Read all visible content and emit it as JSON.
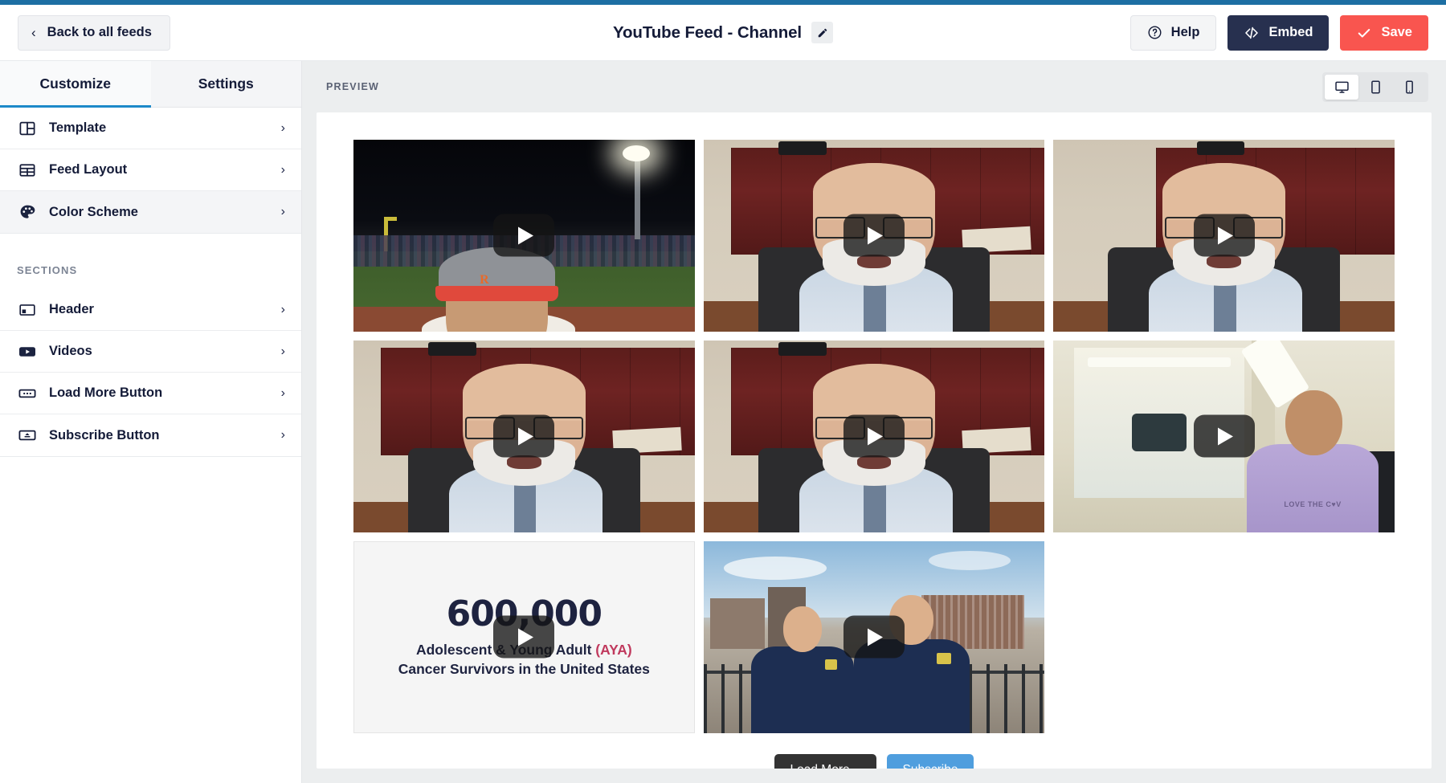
{
  "header": {
    "back_label": "Back to all feeds",
    "back_icon": "chevron-left-icon",
    "title": "YouTube Feed - Channel",
    "edit_icon": "pencil-icon",
    "help_label": "Help",
    "help_icon": "question-circle-icon",
    "embed_label": "Embed",
    "embed_icon": "code-brackets-icon",
    "save_label": "Save",
    "save_icon": "checkmark-icon",
    "colors": {
      "embed_bg": "#27304f",
      "save_bg": "#f9554f",
      "top_strip": "#1d6fa3"
    }
  },
  "sidebar": {
    "tabs": [
      {
        "label": "Customize",
        "active": true
      },
      {
        "label": "Settings",
        "active": false
      }
    ],
    "main_items": [
      {
        "label": "Template",
        "icon": "template-layout-icon",
        "chevron": "›",
        "selected": false
      },
      {
        "label": "Feed Layout",
        "icon": "grid-layout-icon",
        "chevron": "›",
        "selected": false
      },
      {
        "label": "Color Scheme",
        "icon": "palette-icon",
        "chevron": "›",
        "selected": true
      }
    ],
    "sections_heading": "SECTIONS",
    "section_items": [
      {
        "label": "Header",
        "icon": "header-block-icon",
        "chevron": "›"
      },
      {
        "label": "Videos",
        "icon": "youtube-play-icon",
        "chevron": "›"
      },
      {
        "label": "Load More Button",
        "icon": "load-more-icon",
        "chevron": "›"
      },
      {
        "label": "Subscribe Button",
        "icon": "subscribe-icon",
        "chevron": "›"
      }
    ],
    "accent_color": "#1d89c9"
  },
  "preview": {
    "label": "PREVIEW",
    "devices": [
      {
        "name": "desktop",
        "icon": "monitor-icon",
        "active": true
      },
      {
        "name": "tablet",
        "icon": "tablet-icon",
        "active": false
      },
      {
        "name": "mobile",
        "icon": "mobile-icon",
        "active": false
      }
    ],
    "videos": [
      {
        "id": 1,
        "kind": "football-night-game",
        "alt": "Night football game with spectator wearing R cap",
        "play_icon": "play-icon"
      },
      {
        "id": 2,
        "kind": "office-man",
        "alt": "Bearded man with glasses in office",
        "play_icon": "play-icon"
      },
      {
        "id": 3,
        "kind": "office-man",
        "alt": "Bearded man with glasses in office",
        "play_icon": "play-icon"
      },
      {
        "id": 4,
        "kind": "office-man",
        "alt": "Bearded man with glasses in office",
        "play_icon": "play-icon"
      },
      {
        "id": 5,
        "kind": "office-man",
        "alt": "Bearded man with glasses in office",
        "play_icon": "play-icon"
      },
      {
        "id": 6,
        "kind": "hallway-purple-shirt",
        "alt": "Man in purple LOVE THE COV shirt in hallway",
        "shirt_text": "LOVE THE C♥V",
        "play_icon": "play-icon"
      },
      {
        "id": 7,
        "kind": "statistic-card",
        "alt": "Statistic title card",
        "play_icon": "play-icon"
      },
      {
        "id": 8,
        "kind": "two-men-city",
        "alt": "Two men in navy polos on a city rooftop",
        "play_icon": "play-icon"
      }
    ],
    "stat_card": {
      "number": "600,000",
      "line1_prefix": "Adolescent & Young Adult ",
      "line1_highlight": "(AYA)",
      "line2": "Cancer Survivors in the United States",
      "highlight_color": "#c0395d"
    },
    "load_more_label": "Load More...",
    "subscribe_label": "Subscribe",
    "load_more_color": "#333333",
    "subscribe_color": "#4f9ede"
  }
}
